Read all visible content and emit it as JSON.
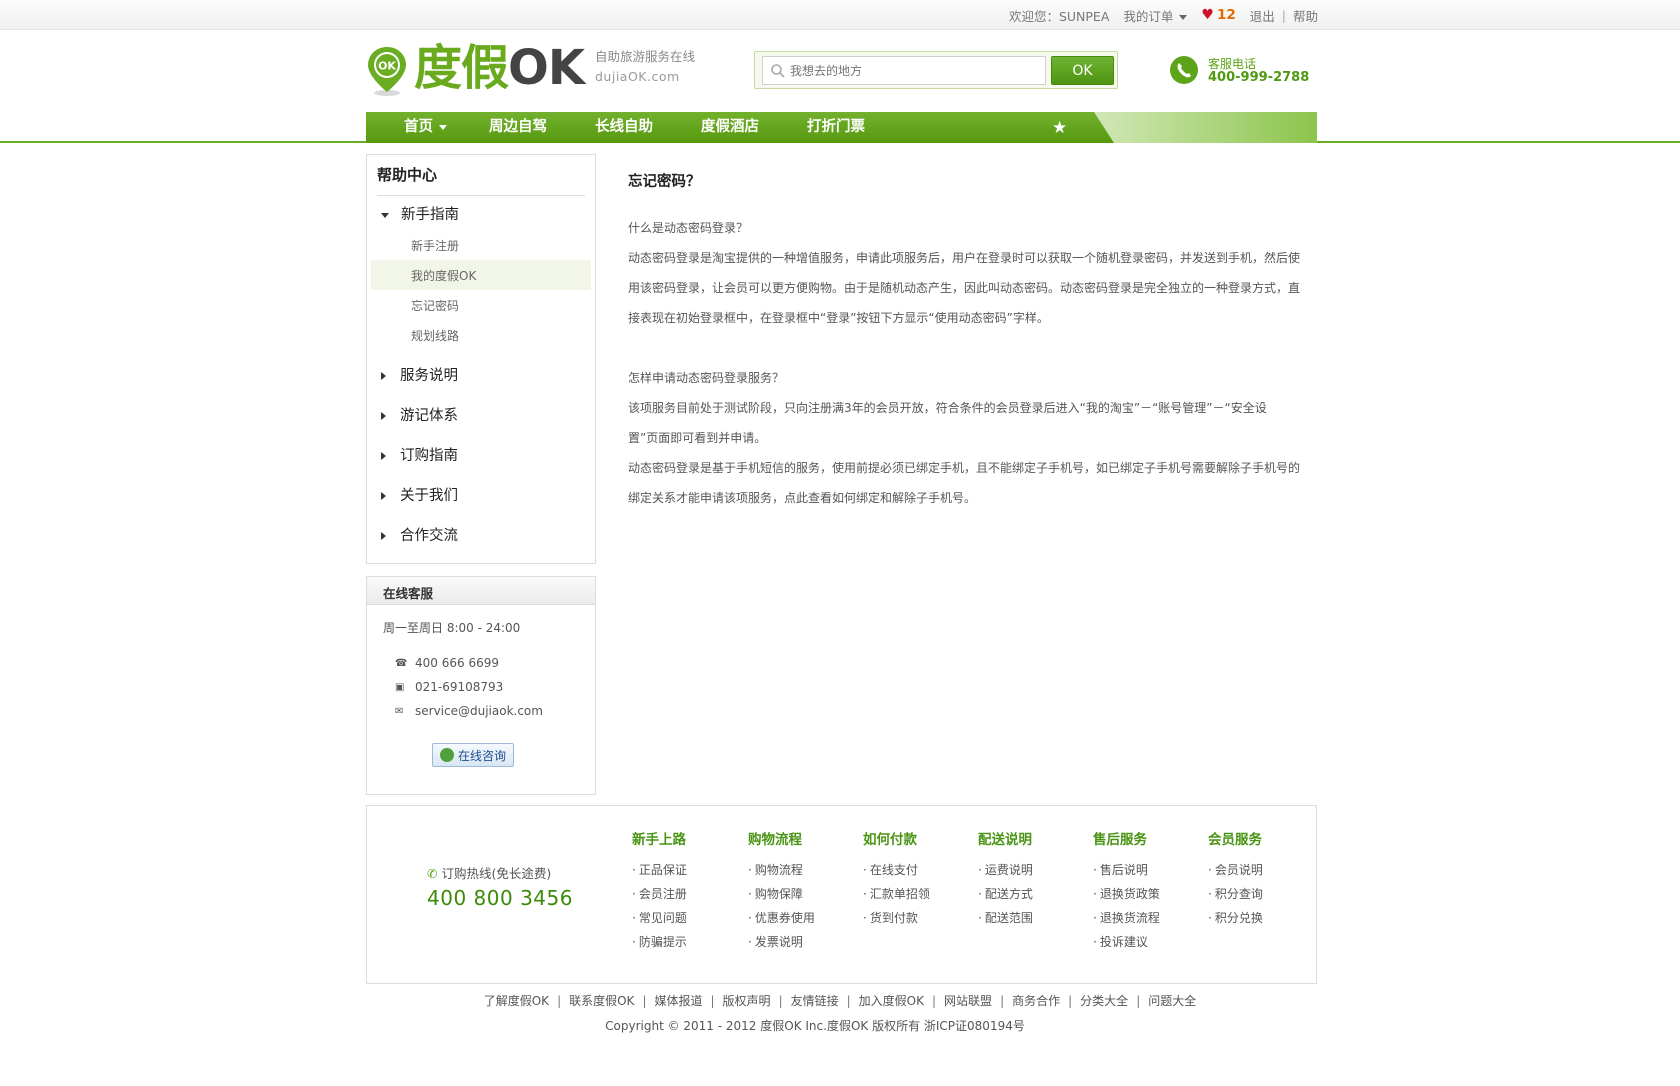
{
  "topbar": {
    "welcome": "欢迎您：SUNPEA",
    "my_orders": "我的订单",
    "fav_count": "12",
    "logout": "退出",
    "separator": "|",
    "help": "帮助"
  },
  "header": {
    "logo_badge": "OK",
    "logo_cn": "度假",
    "logo_ok": "OK",
    "slogan": "自助旅游服务在线",
    "domain": "dujiaOK.com",
    "search_placeholder": "我想去的地方",
    "search_button": "OK",
    "hotline_label": "客服电话",
    "hotline_number": "400-999-2788"
  },
  "nav": {
    "items": [
      "首页",
      "周边自驾",
      "长线自助",
      "度假酒店",
      "打折门票"
    ]
  },
  "sidebar": {
    "title": "帮助中心",
    "categories": [
      "新手指南",
      "服务说明",
      "游记体系",
      "订购指南",
      "关于我们",
      "合作交流"
    ],
    "sub_items": [
      "新手注册",
      "我的度假OK",
      "忘记密码",
      "规划线路"
    ]
  },
  "service": {
    "title": "在线客服",
    "hours": "周一至周日 8:00 - 24:00",
    "phone": "400 666 6699",
    "fax": "021-69108793",
    "email": "service@dujiaok.com",
    "consult_button": "在线咨询"
  },
  "article": {
    "title": "忘记密码？",
    "q1": "什么是动态密码登录？",
    "a1": "动态密码登录是淘宝提供的一种增值服务，申请此项服务后，用户在登录时可以获取一个随机登录密码，并发送到手机，然后使\n用该密码登录，让会员可以更方便购物。由于是随机动态产生，因此叫动态密码。动态密码登录是完全独立的一种登录方式，直\n接表现在初始登录框中，在登录框中“登录”按钮下方显示“使用动态密码”字样。",
    "q2": "怎样申请动态密码登录服务？",
    "a2": "该项服务目前处于测试阶段，只向注册满3年的会员开放，符合条件的会员登录后进入“我的淘宝”－“账号管理”－“安全设\n置”页面即可看到并申请。",
    "a3": "动态密码登录是基于手机短信的服务，使用前提必须已绑定手机，且不能绑定子手机号，如已绑定子手机号需要解除子手机号的\n绑定关系才能申请该项服务，点此查看如何绑定和解除子手机号。"
  },
  "footer": {
    "hotline_label": "订购热线(免长途费)",
    "hotline_number": "400 800 3456",
    "columns": [
      {
        "heading": "新手上路",
        "links": [
          "正品保证",
          "会员注册",
          "常见问题",
          "防骗提示"
        ]
      },
      {
        "heading": "购物流程",
        "links": [
          "购物流程",
          "购物保障",
          "优惠券使用",
          "发票说明"
        ]
      },
      {
        "heading": "如何付款",
        "links": [
          "在线支付",
          "汇款单招领",
          "货到付款"
        ]
      },
      {
        "heading": "配送说明",
        "links": [
          "运费说明",
          "配送方式",
          "配送范围"
        ]
      },
      {
        "heading": "售后服务",
        "links": [
          "售后说明",
          "退换货政策",
          "退换货流程",
          "投诉建议"
        ]
      },
      {
        "heading": "会员服务",
        "links": [
          "会员说明",
          "积分查询",
          "积分兑换"
        ]
      }
    ],
    "bottom_links": [
      "了解度假OK",
      "联系度假OK",
      "媒体报道",
      "版权声明",
      "友情链接",
      "加入度假OK",
      "网站联盟",
      "商务合作",
      "分类大全",
      "问题大全"
    ],
    "link_separator": "|",
    "copyright": "Copyright © 2011 - 2012 度假OK Inc.度假OK 版权所有 浙ICP证080194号"
  },
  "colors": {
    "brand_green": "#6aac22",
    "nav_green": "#56990f",
    "heading_green": "#4a9414",
    "fav_heart": "#d0112b",
    "fav_count": "#e66a00"
  }
}
